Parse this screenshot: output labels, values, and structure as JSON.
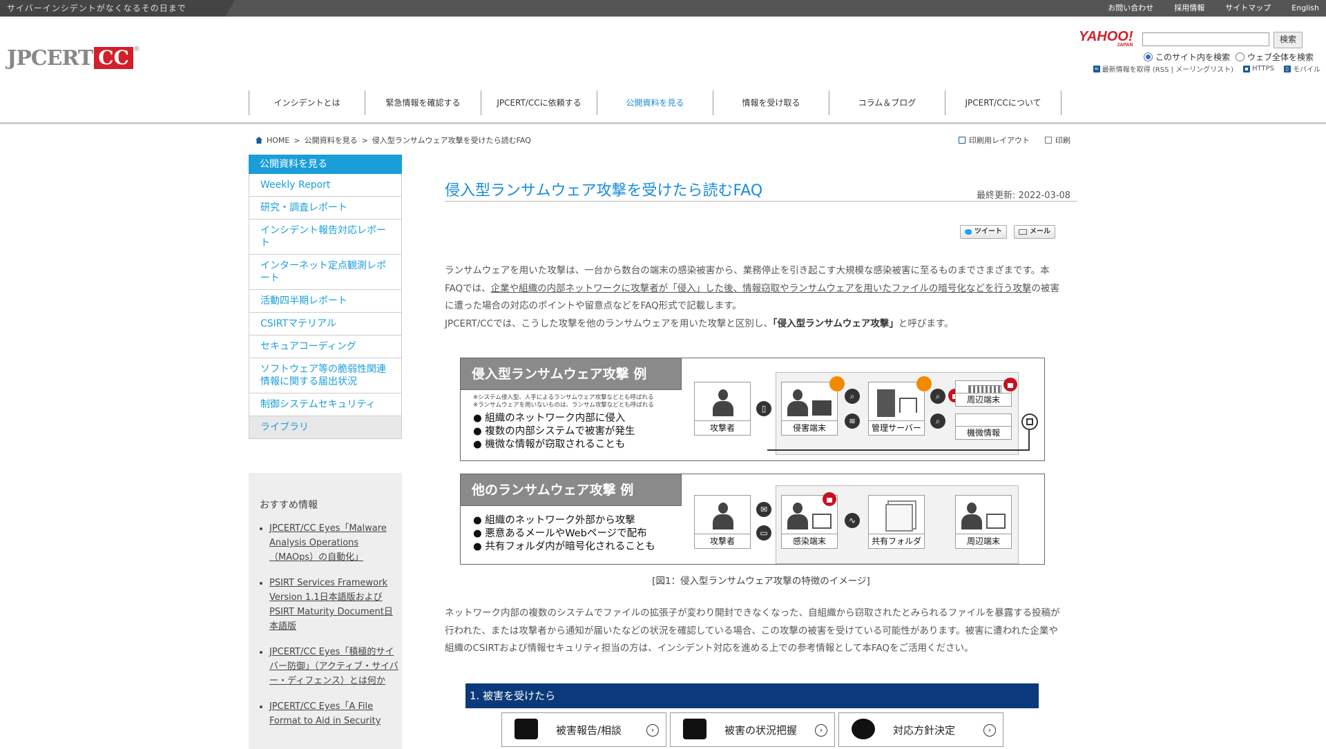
{
  "topbar": {
    "tagline": "サイバーインシデントがなくなるその日まで",
    "links": [
      "お問い合わせ",
      "採用情報",
      "サイトマップ",
      "English"
    ]
  },
  "logo": {
    "jp": "JPCERT",
    "cc": "CC",
    "reg": "®"
  },
  "search": {
    "yahoo": "YAHOO!",
    "yahoo_sub": "JAPAN",
    "placeholder": "",
    "button": "検索",
    "radio_site": "このサイト内を検索",
    "radio_web": "ウェブ全体を検索",
    "rss": "最新情報を取得 (RSS | メーリングリスト)",
    "https": "HTTPS",
    "mobile": "モバイル"
  },
  "nav": [
    "インシデントとは",
    "緊急情報を確認する",
    "JPCERT/CCに依頼する",
    "公開資料を見る",
    "情報を受け取る",
    "コラム＆ブログ",
    "JPCERT/CCについて"
  ],
  "breadcrumb": {
    "home": "HOME",
    "sep": ">",
    "level1": "公開資料を見る",
    "current": "侵入型ランサムウェア攻撃を受けたら読むFAQ"
  },
  "print": {
    "layout": "印刷用レイアウト",
    "print": "印刷"
  },
  "sidebar": {
    "head": "公開資料を見る",
    "items": [
      "Weekly Report",
      "研究・調査レポート",
      "インシデント報告対応レポート",
      "インターネット定点観測レポート",
      "活動四半期レポート",
      "CSIRTマテリアル",
      "セキュアコーディング",
      "ソフトウェア等の脆弱性関連情報に関する届出状況",
      "制御システムセキュリティ",
      "ライブラリ"
    ]
  },
  "recommend": {
    "title": "おすすめ情報",
    "items": [
      "JPCERT/CC Eyes「Malware Analysis Operations（MAOps）の自動化」",
      "PSIRT Services Framework Version 1.1日本語版およびPSIRT Maturity Document日本語版",
      "JPCERT/CC Eyes「積極的サイバー防御」（アクティブ・サイバー・ディフェンス）とは何か",
      "JPCERT/CC Eyes「A File Format to Aid in Security"
    ]
  },
  "article": {
    "title": "侵入型ランサムウェア攻撃を受けたら読むFAQ",
    "updated": "最終更新: 2022-03-08",
    "share_tweet": "ツイート",
    "share_mail": "メール",
    "p1a": "ランサムウェアを用いた攻撃は、一台から数台の端末の感染被害から、業務停止を引き起こす大規模な感染被害に至るものまでさまざまです。本FAQでは、",
    "p1link": "企業や組織の内部ネットワークに攻撃者が「侵入」した後、情報窃取やランサムウェアを用いたファイルの暗号化などを行う攻撃",
    "p1b": "の被害に遭った場合の対応のポイントや留意点などをFAQ形式で記載します。",
    "p2a": "JPCERT/CCでは、こうした攻撃を他のランサムウェアを用いた攻撃と区別し、",
    "p2b": "「侵入型ランサムウェア攻撃」",
    "p2c": "と呼びます。",
    "caption": "[図1：侵入型ランサムウェア攻撃の特徴のイメージ]",
    "p3": "ネットワーク内部の複数のシステムでファイルの拡張子が変わり開封できなくなった、自組織から窃取されたとみられるファイルを暴露する投稿が行われた、または攻撃者から通知が届いたなどの状況を確認している場合、この攻撃の被害を受けている可能性があります。被害に遭われた企業や組織のCSIRTおよび情報セキュリティ担当の方は、インシデント対応を進める上での参考情報として本FAQをご活用ください。",
    "section1": "1. 被害を受けたら",
    "section_buttons": [
      "被害報告/相談",
      "被害の状況把握",
      "対応方針決定"
    ]
  },
  "figure": {
    "top": {
      "label": "侵入型ランサムウェア攻撃 例",
      "note1": "※システム侵入型、人手によるランサムウェア攻撃などとも呼ばれる",
      "note2": "※ランサムウェアを用いないものは、ランサム攻撃などとも呼ばれる",
      "bullets": [
        "組織のネットワーク内部に侵入",
        "複数の内部システムで被害が発生",
        "機微な情報が窃取されることも"
      ],
      "nodes": [
        "攻撃者",
        "侵害端末",
        "管理サーバー",
        "周辺端末",
        "機微情報"
      ]
    },
    "bottom": {
      "label": "他のランサムウェア攻撃 例",
      "bullets": [
        "組織のネットワーク外部から攻撃",
        "悪意あるメールやWebページで配布",
        "共有フォルダ内が暗号化されることも"
      ],
      "nodes": [
        "攻撃者",
        "感染端末",
        "共有フォルダ",
        "周辺端末"
      ]
    }
  },
  "colors": {
    "accent": "#1a8cd8",
    "sidebar_head": "#1a9ed9",
    "section_bar": "#0b3a7a",
    "logo_red": "#d1202a"
  }
}
